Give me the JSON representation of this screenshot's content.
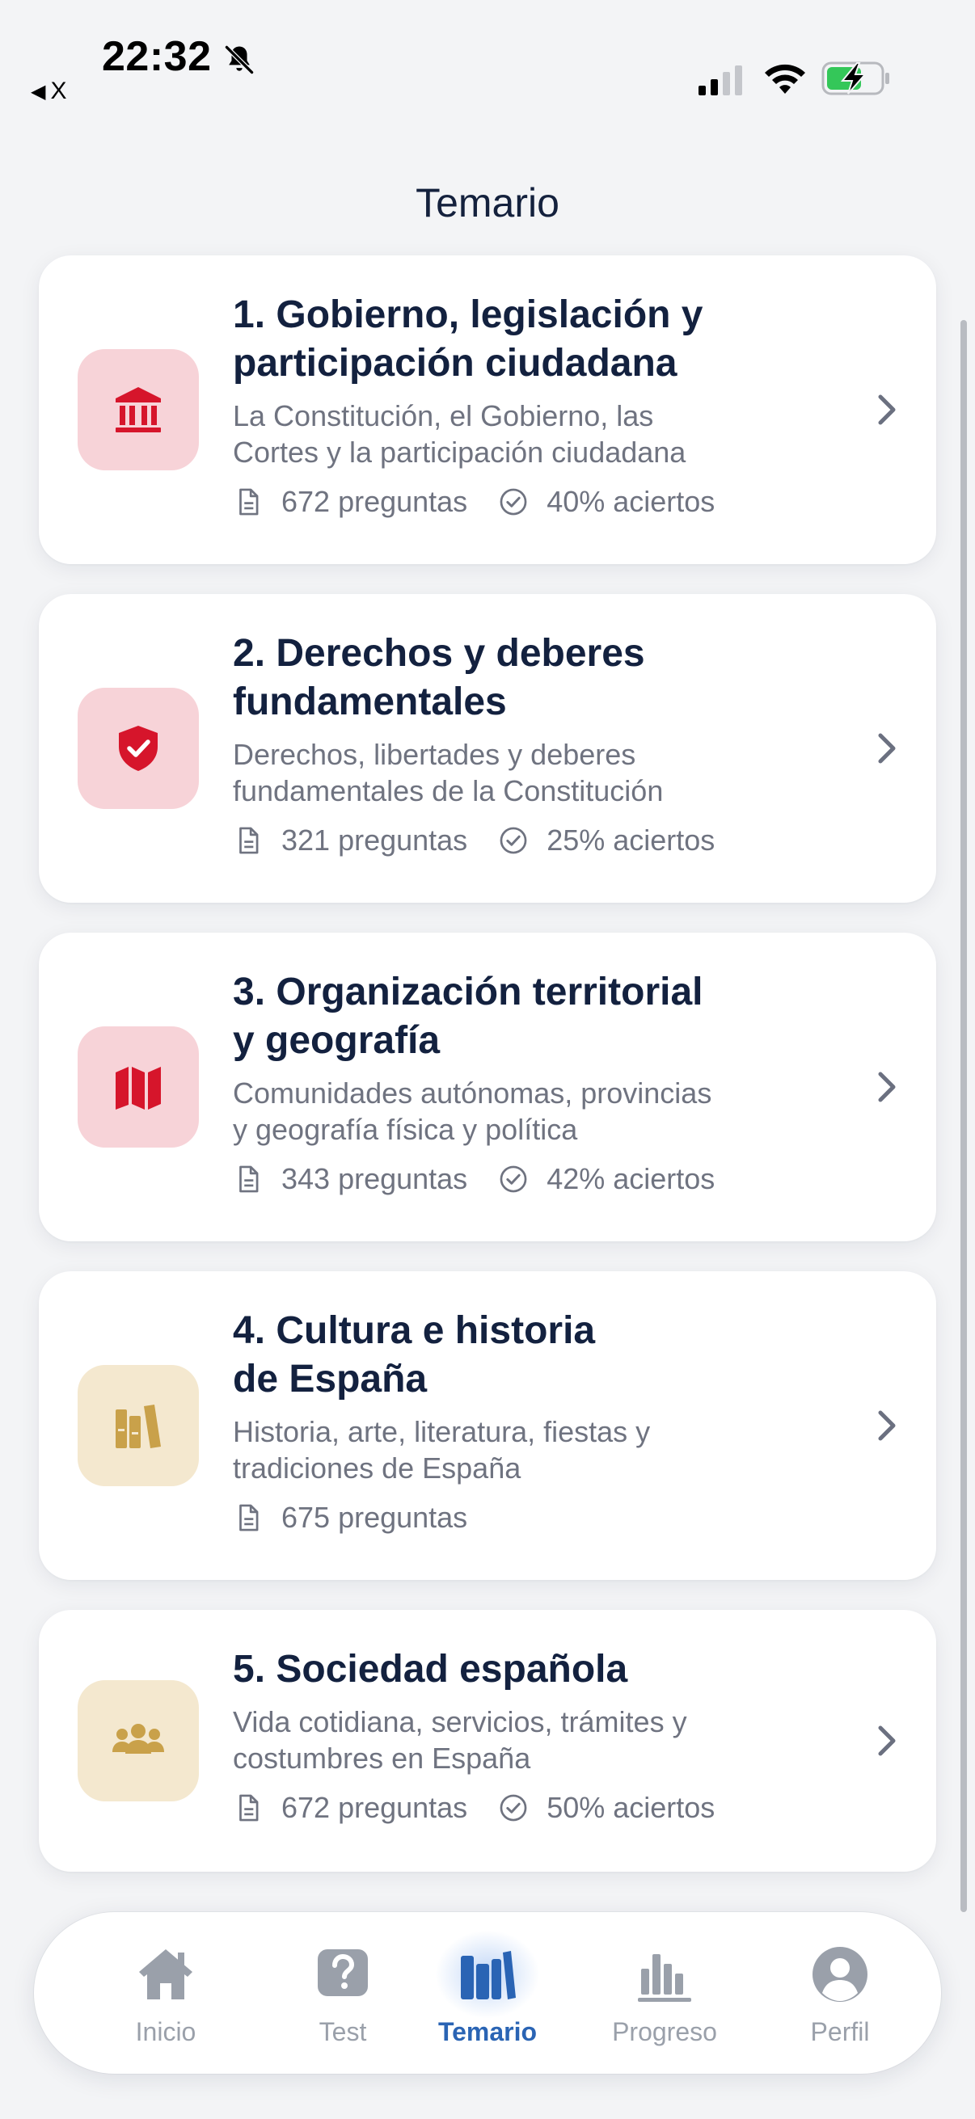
{
  "status_bar": {
    "time": "22:32",
    "back_label": "X",
    "icons": [
      "bell-slash-icon",
      "signal-icon",
      "wifi-icon",
      "battery-charging-icon"
    ],
    "battery_color": "#34c759"
  },
  "page": {
    "title": "Temario"
  },
  "topics": [
    {
      "title": "1. Gobierno, legislación y\nparticipación ciudadana",
      "description": "La Constitución, el Gobierno, las\nCortes y la participación ciudadana",
      "questions": "672 preguntas",
      "score": "40% aciertos",
      "icon": "government-building-icon",
      "icon_color": "#d6152b"
    },
    {
      "title": "2. Derechos y deberes\nfundamentales",
      "description": "Derechos, libertades y deberes\nfundamentales de la Constitución",
      "questions": "321 preguntas",
      "score": "25% aciertos",
      "icon": "shield-check-icon",
      "icon_color": "#d6152b"
    },
    {
      "title": "3. Organización territorial\ny geografía",
      "description": "Comunidades autónomas, provincias\ny geografía física y política",
      "questions": "343 preguntas",
      "score": "42% aciertos",
      "icon": "map-icon",
      "icon_color": "#d6152b"
    },
    {
      "title": "4. Cultura e historia\nde España",
      "description": "Historia, arte, literatura, fiestas y\ntradiciones de España",
      "questions": "675 preguntas",
      "score": null,
      "icon": "books-icon",
      "icon_color": "#c9a14a"
    },
    {
      "title": "5. Sociedad española",
      "description": "Vida cotidiana, servicios, trámites y\ncostumbres en España",
      "questions": "672 preguntas",
      "score": "50% aciertos",
      "icon": "people-group-icon",
      "icon_color": "#c9a14a"
    }
  ],
  "tab_bar": {
    "active": "Temario",
    "active_color": "#2a64b4",
    "inactive_color": "#9aa0aa",
    "tabs": [
      {
        "label": "Inicio",
        "icon": "home-icon"
      },
      {
        "label": "Test",
        "icon": "question-mark-icon"
      },
      {
        "label": "Temario",
        "icon": "books-icon"
      },
      {
        "label": "Progreso",
        "icon": "bar-chart-icon"
      },
      {
        "label": "Perfil",
        "icon": "profile-icon"
      }
    ]
  }
}
